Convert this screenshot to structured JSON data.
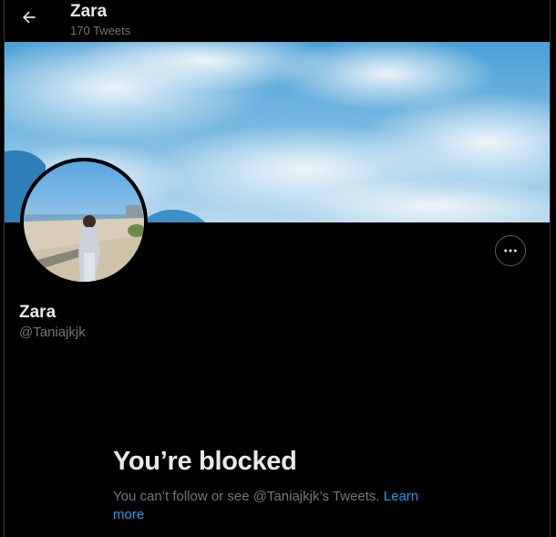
{
  "header": {
    "title": "Zara",
    "tweet_count": "170 Tweets",
    "back_icon": "arrow-left-icon"
  },
  "profile": {
    "display_name": "Zara",
    "handle": "@Taniajkjk",
    "more_icon": "more-horizontal-icon"
  },
  "blocked": {
    "title": "You’re blocked",
    "message": "You can’t follow or see @Taniajkjk’s Tweets.",
    "link_label": "Learn more"
  },
  "colors": {
    "background": "#000000",
    "text_primary": "#e7e9ea",
    "text_secondary": "#71767b",
    "link": "#1d9bf0",
    "border": "#2f3336"
  }
}
